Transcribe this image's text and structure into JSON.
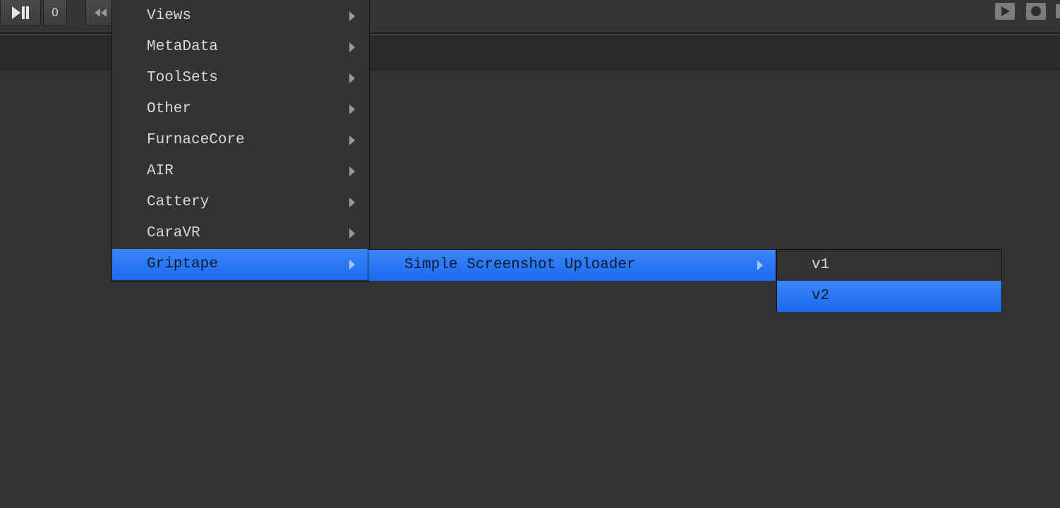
{
  "toolbar": {
    "frame_value": "0",
    "step_icon": "play-pause-step-icon",
    "rewind_icon": "rewind-icon",
    "play_icon": "play-icon",
    "record_icon": "record-icon"
  },
  "menu_main": {
    "items": [
      {
        "label": "Views"
      },
      {
        "label": "MetaData"
      },
      {
        "label": "ToolSets"
      },
      {
        "label": "Other"
      },
      {
        "label": "FurnaceCore"
      },
      {
        "label": "AIR"
      },
      {
        "label": "Cattery"
      },
      {
        "label": "CaraVR"
      },
      {
        "label": "Griptape"
      }
    ]
  },
  "menu_griptape": {
    "items": [
      {
        "label": "Simple Screenshot Uploader"
      }
    ]
  },
  "menu_uploader": {
    "items": [
      {
        "label": "v1"
      },
      {
        "label": "v2"
      }
    ]
  },
  "colors": {
    "background": "#323232",
    "menu_bg": "#333333",
    "highlight": "#2574f5",
    "text": "#d9d9d9"
  }
}
